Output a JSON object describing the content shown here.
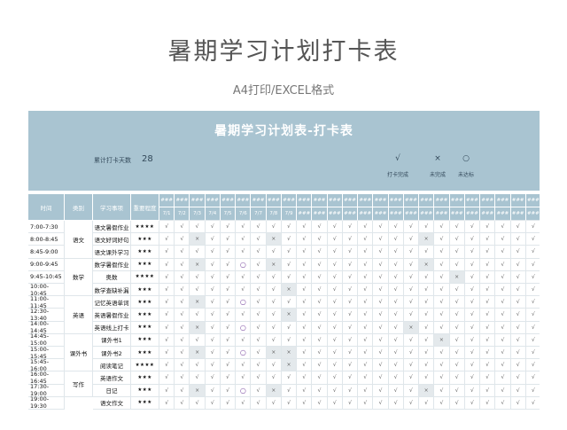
{
  "page": {
    "title": "暑期学习计划打卡表",
    "subtitle": "A4打印/EXCEL格式"
  },
  "sheet": {
    "title": "暑期学习计划表-打卡表",
    "count_label": "累计打卡天数",
    "count_value": "28",
    "legend": [
      {
        "symbol": "√",
        "label": "打卡完成"
      },
      {
        "symbol": "×",
        "label": "未完成"
      },
      {
        "symbol": "○",
        "label": "未达标"
      }
    ],
    "headers": {
      "time": "时间",
      "category": "类别",
      "item": "学习事项",
      "importance": "重要程度"
    },
    "date_mask": "###",
    "dates": [
      "7/1",
      "7/2",
      "7/3",
      "7/4",
      "7/5",
      "7/6",
      "7/7",
      "7/8",
      "7/9",
      "###",
      "###",
      "###",
      "###",
      "###",
      "###",
      "###",
      "###",
      "###",
      "###",
      "###",
      "###",
      "###",
      "###",
      "###",
      "###"
    ],
    "groups": [
      {
        "label": "语文",
        "start": 0,
        "span": 3
      },
      {
        "label": "数学",
        "start": 3,
        "span": 3
      },
      {
        "label": "英语",
        "start": 6,
        "span": 3
      },
      {
        "label": "课外书",
        "start": 9,
        "span": 3
      },
      {
        "label": "写作",
        "start": 12,
        "span": 2
      }
    ],
    "rows": [
      {
        "time": "7:00-7:30",
        "item": "语文暑假作业",
        "importance": "★★★★",
        "marks": "vvvvvvvvvvvvvvvvvvvvvvvvv"
      },
      {
        "time": "8:00-8:45",
        "item": "语文好词好句",
        "importance": "★★★",
        "marks": "vvxvvvvxvvvvvvvvvxvvvvvvv"
      },
      {
        "time": "8:45-9:00",
        "item": "语文课外学习",
        "importance": "★★★",
        "marks": "vvvvvvvvvvvvvvvvvvvvvvvvv"
      },
      {
        "time": "9:00-9:45",
        "item": "数学暑假作业",
        "importance": "★★★",
        "marks": "vvxvvovxvvvvvvvvvxvvvvvvv"
      },
      {
        "time": "9:45-10:45",
        "item": "奥数",
        "importance": "★★★★",
        "marks": "vvvvvvvvvvvvvvvvvvvxvvvvv"
      },
      {
        "time": "10:00-10:45",
        "item": "数学查缺补漏",
        "importance": "★★★",
        "marks": "vvvvvvvvxvvvvvvvvvvvvvvvv"
      },
      {
        "time": "11:00-11:45",
        "item": "记忆英语单词",
        "importance": "★★★",
        "marks": "vvxvvovvvvvvvvvvvvvvvvvvv"
      },
      {
        "time": "12:30-13:40",
        "item": "英语暑假作业",
        "importance": "★★★",
        "marks": "vvvvvvvvxvvvvvvvvvvvvvvvv"
      },
      {
        "time": "14:00-14:45",
        "item": "英语线上打卡",
        "importance": "★★★",
        "marks": "vvxvvovvvvvvvvvvxvvvvvvvv"
      },
      {
        "time": "14:45-15:00",
        "item": "课外书1",
        "importance": "★★★",
        "marks": "vvvvvvvvvvvvvvvvvvxvvvvvv"
      },
      {
        "time": "15:00-15:45",
        "item": "课外书2",
        "importance": "★★★",
        "marks": "vvxvvovxxvvvvvvvvvvvvvvvv"
      },
      {
        "time": "15:45-16:00",
        "item": "阅读笔记",
        "importance": "★★★★",
        "marks": "vvvvvvvvxvvvvvvvvvvvvvvvv"
      },
      {
        "time": "16:00-16:45",
        "item": "英语作文",
        "importance": "★★★",
        "marks": "vvvvvvvvvvvvvvvvvvvvvvvvv"
      },
      {
        "time": "17:30-19:00",
        "item": "日记",
        "importance": "★★★",
        "marks": "vvxvvovxvvvvvvvvvxvvvvvvv"
      },
      {
        "time": "19:00-19:30",
        "item": "语文作文",
        "importance": "★★★",
        "marks": "vvvvvvvvvvvvvvvvvvvvvvvvv"
      }
    ]
  }
}
